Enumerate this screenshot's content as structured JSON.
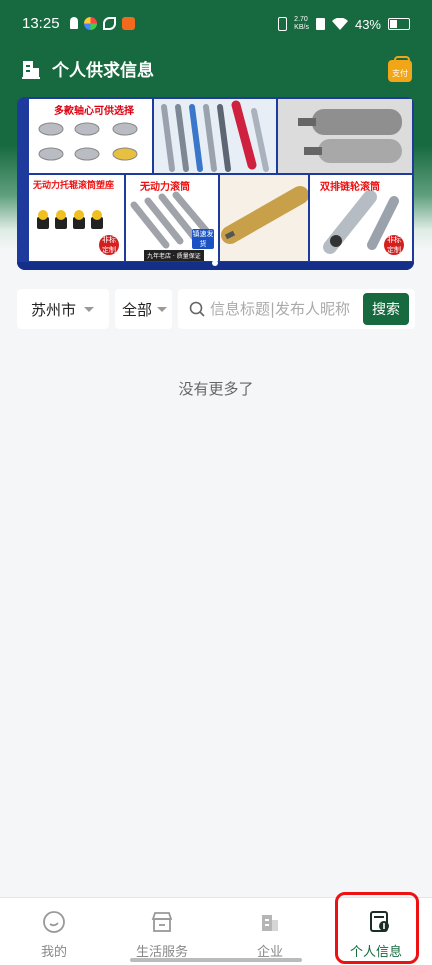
{
  "status_bar": {
    "time": "13:25",
    "net_speed": "2.70\nKB/s",
    "battery": "43%"
  },
  "header": {
    "title": "个人供求信息",
    "pay_label": "支付"
  },
  "banner": {
    "panels": [
      {
        "title": "多款轴心可供选择"
      },
      {
        "title": "无动力托辊滚筒塑座",
        "badges": [
          "非标定制"
        ]
      },
      {
        "title": "无动力滚筒",
        "badges": [
          "镇速发货"
        ],
        "footer": "九年老店 · 质量保证"
      },
      {
        "title": "双排链轮滚筒",
        "badges": [
          "非标定制"
        ]
      }
    ]
  },
  "filters": {
    "city": "苏州市",
    "category": "全部",
    "search_placeholder": "信息标题|发布人昵称",
    "search_button": "搜索"
  },
  "list": {
    "empty_text": "没有更多了"
  },
  "tabbar": {
    "tabs": [
      {
        "label": "我的",
        "icon": "smile-icon",
        "active": false
      },
      {
        "label": "生活服务",
        "icon": "shop-icon",
        "active": false
      },
      {
        "label": "企业",
        "icon": "building-icon",
        "active": false
      },
      {
        "label": "个人信息",
        "icon": "info-card-icon",
        "active": true
      }
    ]
  },
  "colors": {
    "brand": "#17693f",
    "highlight": "#e11111",
    "pay": "#f2a516"
  }
}
